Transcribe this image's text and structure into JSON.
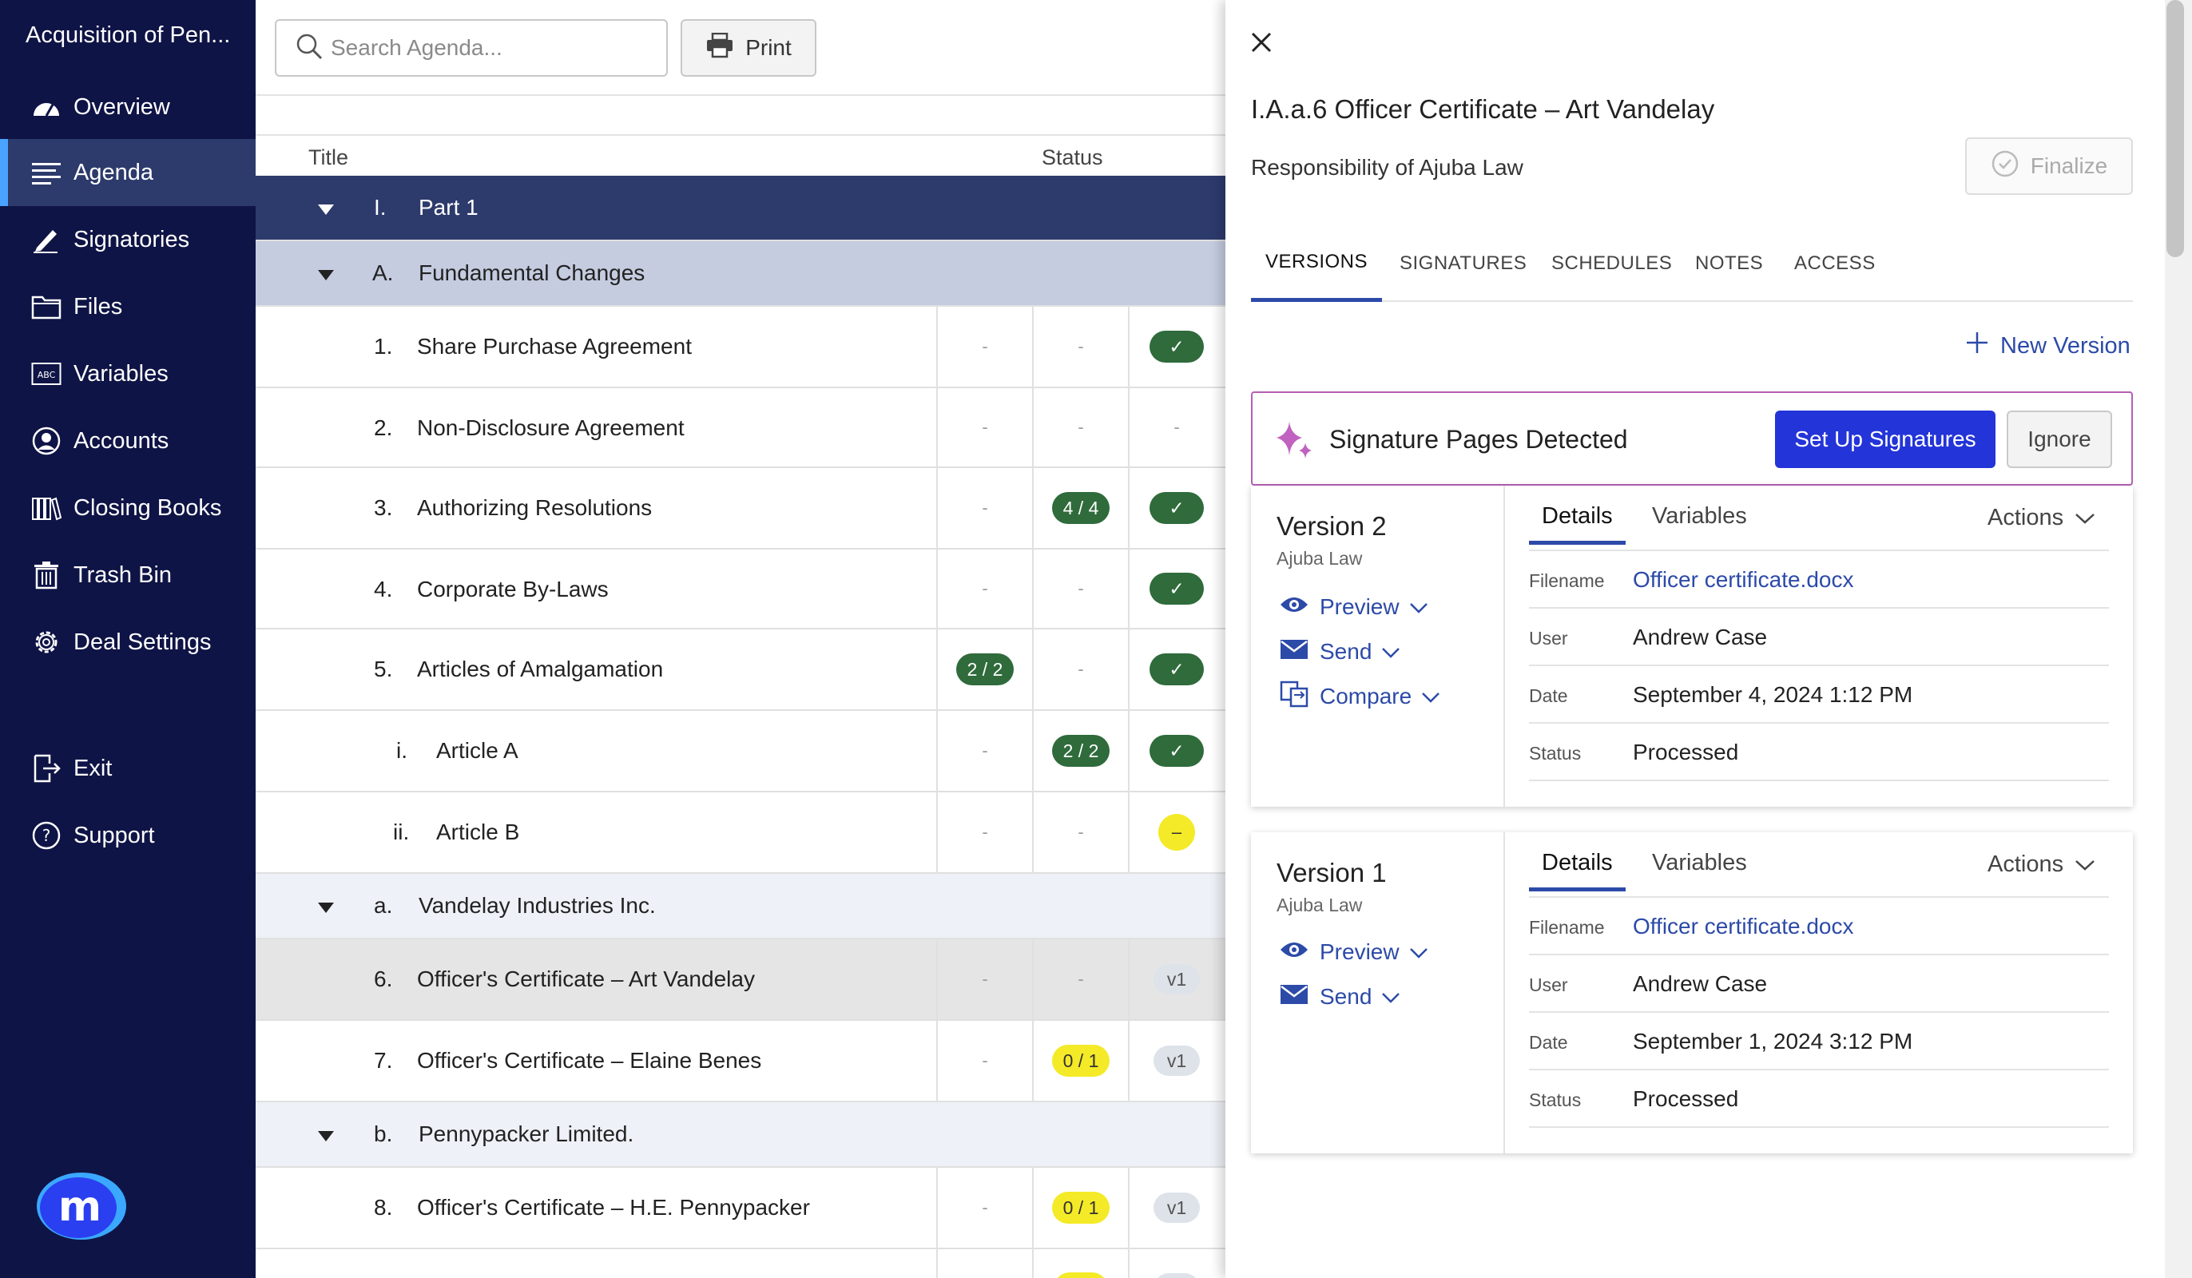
{
  "sidebar": {
    "title": "Acquisition of Pen...",
    "items": [
      {
        "label": "Overview",
        "icon": "gauge-icon"
      },
      {
        "label": "Agenda",
        "icon": "list-icon"
      },
      {
        "label": "Signatories",
        "icon": "pen-icon"
      },
      {
        "label": "Files",
        "icon": "folder-icon"
      },
      {
        "label": "Variables",
        "icon": "variables-icon"
      },
      {
        "label": "Accounts",
        "icon": "user-icon"
      },
      {
        "label": "Closing Books",
        "icon": "books-icon"
      },
      {
        "label": "Trash Bin",
        "icon": "trash-icon"
      },
      {
        "label": "Deal Settings",
        "icon": "gear-icon"
      },
      {
        "label": "Exit",
        "icon": "exit-icon"
      },
      {
        "label": "Support",
        "icon": "help-icon"
      }
    ],
    "active": "Agenda",
    "logo_letter": "m"
  },
  "toolbar": {
    "search_placeholder": "Search Agenda...",
    "print_label": "Print"
  },
  "table": {
    "header_title": "Title",
    "header_status": "Status",
    "rows": [
      {
        "num": "I.",
        "title": "Part 1"
      },
      {
        "num": "A.",
        "title": "Fundamental Changes"
      },
      {
        "num": "1.",
        "title": "Share Purchase Agreement",
        "c1": "-",
        "c2": "-",
        "c3": "✓"
      },
      {
        "num": "2.",
        "title": "Non-Disclosure Agreement",
        "c1": "-",
        "c2": "-",
        "c3": "-"
      },
      {
        "num": "3.",
        "title": "Authorizing Resolutions",
        "c1": "-",
        "c2": "4 / 4",
        "c3": "✓"
      },
      {
        "num": "4.",
        "title": "Corporate By-Laws",
        "c1": "-",
        "c2": "-",
        "c3": "✓"
      },
      {
        "num": "5.",
        "title": "Articles of Amalgamation",
        "c1": "2 / 2",
        "c2": "-",
        "c3": "✓"
      },
      {
        "num": "i.",
        "title": "Article A",
        "c1": "-",
        "c2": "2 / 2",
        "c3": "✓"
      },
      {
        "num": "ii.",
        "title": "Article B",
        "c1": "-",
        "c2": "-",
        "c3": "–"
      },
      {
        "num": "a.",
        "title": "Vandelay Industries Inc."
      },
      {
        "num": "6.",
        "title": "Officer's Certificate – Art Vandelay",
        "c1": "-",
        "c2": "-",
        "c3": "v1"
      },
      {
        "num": "7.",
        "title": "Officer's Certificate – Elaine Benes",
        "c1": "-",
        "c2": "0 / 1",
        "c3": "v1"
      },
      {
        "num": "b.",
        "title": "Pennypacker Limited."
      },
      {
        "num": "8.",
        "title": "Officer's Certificate – H.E. Pennypacker",
        "c1": "-",
        "c2": "0 / 1",
        "c3": "v1"
      }
    ]
  },
  "panel": {
    "title": "I.A.a.6 Officer Certificate – Art Vandelay",
    "subtitle": "Responsibility of Ajuba Law",
    "finalize_label": "Finalize",
    "tabs": [
      "VERSIONS",
      "SIGNATURES",
      "SCHEDULES",
      "NOTES",
      "ACCESS"
    ],
    "active_tab": "VERSIONS",
    "new_version_label": "New Version",
    "banner": {
      "text": "Signature Pages Detected",
      "setup_label": "Set Up Signatures",
      "ignore_label": "Ignore"
    },
    "versions": [
      {
        "name": "Version 2",
        "firm": "Ajuba Law",
        "actions": [
          "Preview",
          "Send",
          "Compare"
        ],
        "tab_details": "Details",
        "tab_variables": "Variables",
        "actions_label": "Actions",
        "fields": [
          {
            "k": "Filename",
            "v": "Officer certificate.docx"
          },
          {
            "k": "User",
            "v": "Andrew Case"
          },
          {
            "k": "Date",
            "v": "September 4, 2024 1:12 PM"
          },
          {
            "k": "Status",
            "v": "Processed"
          }
        ]
      },
      {
        "name": "Version 1",
        "firm": "Ajuba Law",
        "actions": [
          "Preview",
          "Send"
        ],
        "tab_details": "Details",
        "tab_variables": "Variables",
        "actions_label": "Actions",
        "fields": [
          {
            "k": "Filename",
            "v": "Officer certificate.docx"
          },
          {
            "k": "User",
            "v": "Andrew Case"
          },
          {
            "k": "Date",
            "v": "September 1, 2024 3:12 PM"
          },
          {
            "k": "Status",
            "v": "Processed"
          }
        ]
      }
    ]
  },
  "colors": {
    "sidebar_bg": "#0f1446",
    "accent": "#2c4aa8",
    "primary_button": "#2334d8",
    "status_green": "#2f6b3b",
    "status_yellow": "#f4ea27",
    "banner_border": "#b65fb3"
  }
}
